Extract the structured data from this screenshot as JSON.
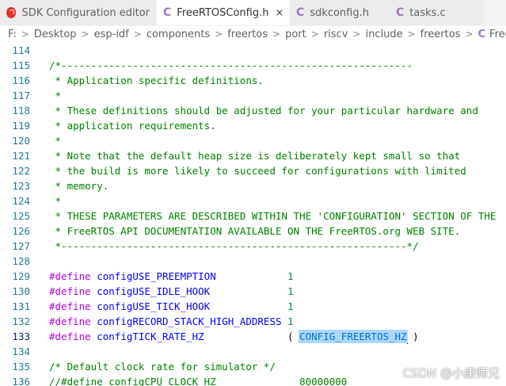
{
  "tabs": [
    {
      "label": "SDK Configuration editor",
      "icon": "esp-idf-icon",
      "active": false,
      "close": ""
    },
    {
      "label": "FreeRTOSConfig.h",
      "icon": "c-file-icon",
      "active": true,
      "close": "×"
    },
    {
      "label": "sdkconfig.h",
      "icon": "c-file-icon",
      "active": false,
      "close": ""
    },
    {
      "label": "tasks.c",
      "icon": "c-file-icon",
      "active": false,
      "close": ""
    }
  ],
  "tab_icon_letter": "C",
  "breadcrumb": [
    "F:",
    "Desktop",
    "esp-idf",
    "components",
    "freertos",
    "port",
    "riscv",
    "include",
    "freertos"
  ],
  "breadcrumb_file": "FreeRTOSConfig.h",
  "breadcrumb_sep": ">",
  "editor": {
    "current_line": "133",
    "lines": [
      {
        "n": "114",
        "t": ""
      },
      {
        "n": "115",
        "t": "/*-----------------------------------------------------------"
      },
      {
        "n": "116",
        "t": " * Application specific definitions."
      },
      {
        "n": "117",
        "t": " *"
      },
      {
        "n": "118",
        "t": " * These definitions should be adjusted for your particular hardware and"
      },
      {
        "n": "119",
        "t": " * application requirements."
      },
      {
        "n": "120",
        "t": " *"
      },
      {
        "n": "121",
        "t": " * Note that the default heap size is deliberately kept small so that"
      },
      {
        "n": "122",
        "t": " * the build is more likely to succeed for configurations with limited"
      },
      {
        "n": "123",
        "t": " * memory."
      },
      {
        "n": "124",
        "t": " *"
      },
      {
        "n": "125",
        "t": " * THESE PARAMETERS ARE DESCRIBED WITHIN THE 'CONFIGURATION' SECTION OF THE"
      },
      {
        "n": "126",
        "t": " * FreeRTOS API DOCUMENTATION AVAILABLE ON THE FreeRTOS.org WEB SITE."
      },
      {
        "n": "127",
        "t": " *----------------------------------------------------------*/"
      },
      {
        "n": "128",
        "t": ""
      },
      {
        "n": "129",
        "define": "#define",
        "name": "configUSE_PREEMPTION",
        "pad": "            ",
        "value": "1"
      },
      {
        "n": "130",
        "define": "#define",
        "name": "configUSE_IDLE_HOOK",
        "pad": "             ",
        "value": "1"
      },
      {
        "n": "131",
        "define": "#define",
        "name": "configUSE_TICK_HOOK",
        "pad": "             ",
        "value": "1"
      },
      {
        "n": "132",
        "define": "#define",
        "name": "configRECORD_STACK_HIGH_ADDRESS",
        "pad": " ",
        "value": "1"
      },
      {
        "n": "133",
        "define": "#define",
        "name": "configTICK_RATE_HZ",
        "pad": "              ",
        "open": "( ",
        "selected": "CONFIG_FREERTOS_HZ",
        "close": " )"
      },
      {
        "n": "134",
        "t": ""
      },
      {
        "n": "135",
        "t": "/* Default clock rate for simulator */"
      },
      {
        "n": "136",
        "t": "//#define configCPU_CLOCK_HZ              80000000"
      }
    ]
  },
  "watermark": "CSDN @小康师兄"
}
